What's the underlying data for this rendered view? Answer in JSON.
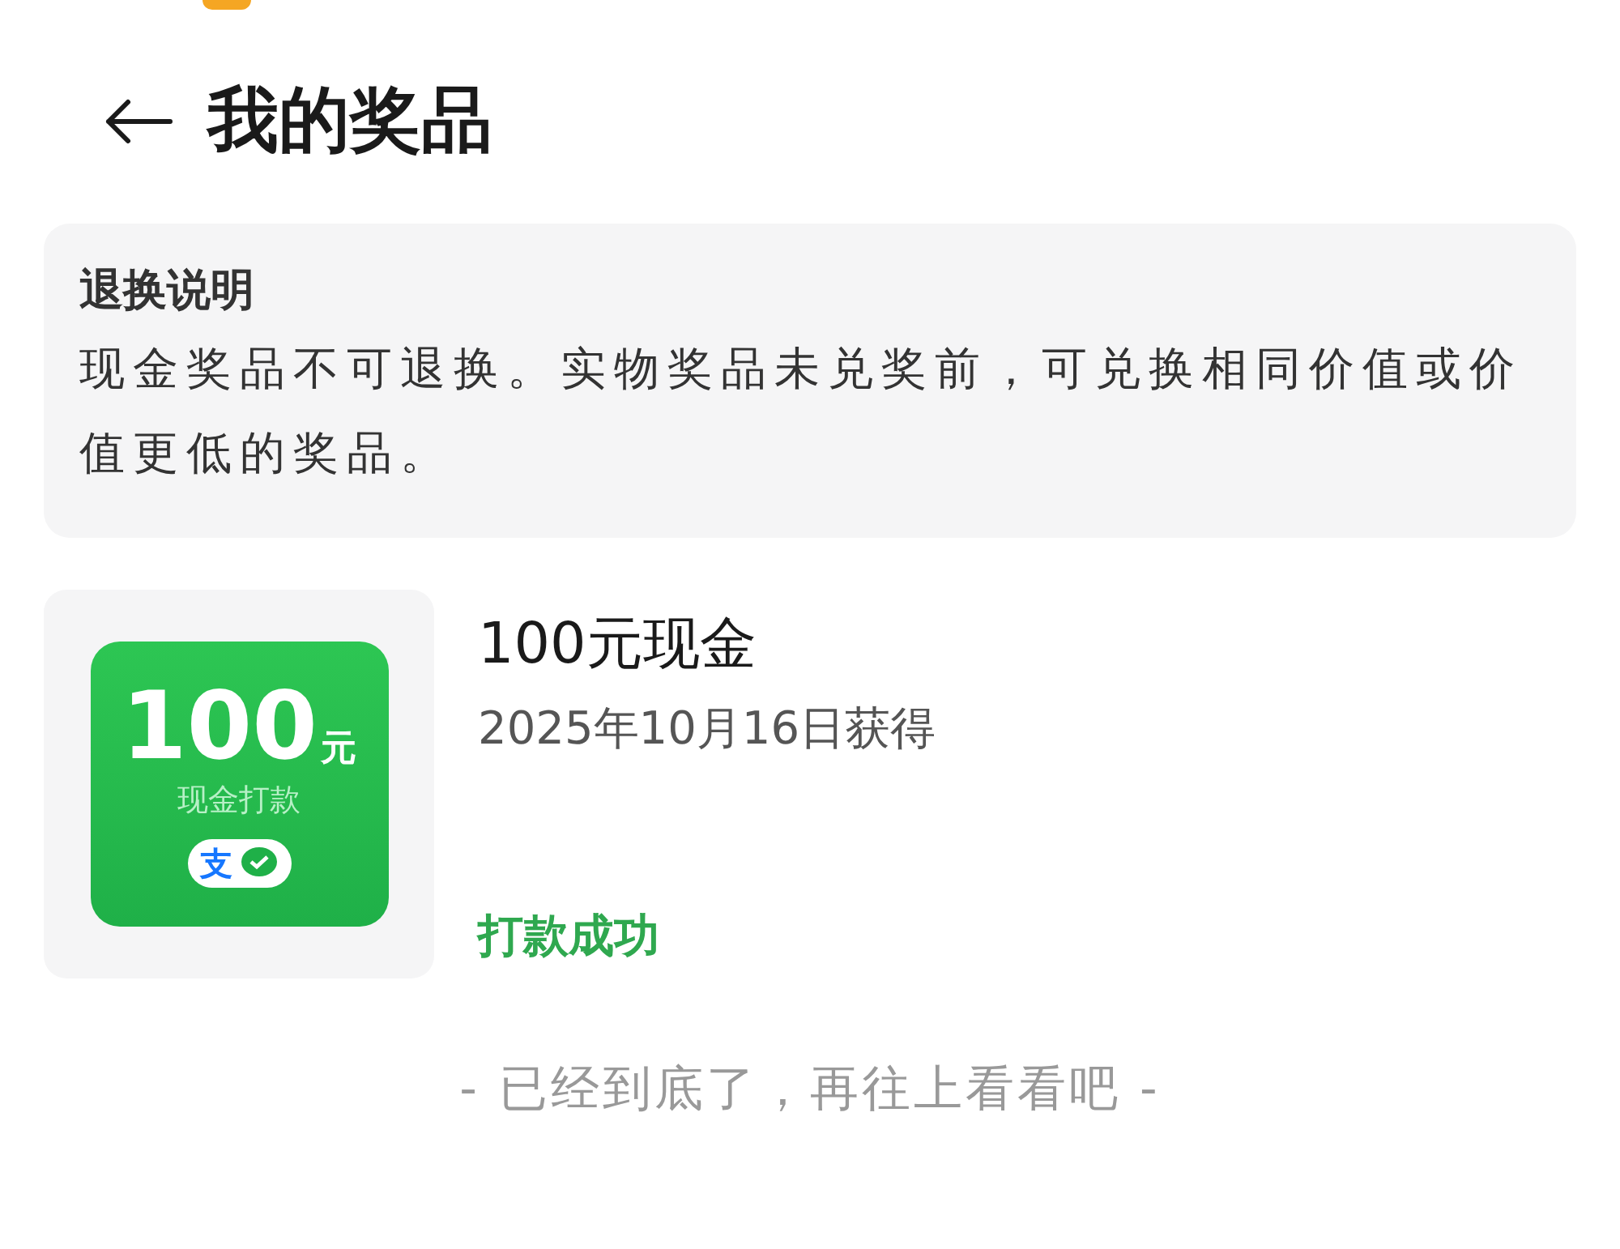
{
  "header": {
    "title": "我的奖品"
  },
  "notice": {
    "title": "退换说明",
    "body": "现金奖品不可退换。实物奖品未兑奖前，可兑换相同价值或价值更低的奖品。"
  },
  "prizes": [
    {
      "thumbnail": {
        "amount": "100",
        "unit": "元",
        "caption": "现金打款",
        "pay_glyph": "支"
      },
      "name": "100元现金",
      "date": "2025年10月16日获得",
      "status": {
        "text": "打款成功",
        "kind": "success"
      }
    }
  ],
  "footer": "- 已经到底了，再往上看看吧 -"
}
